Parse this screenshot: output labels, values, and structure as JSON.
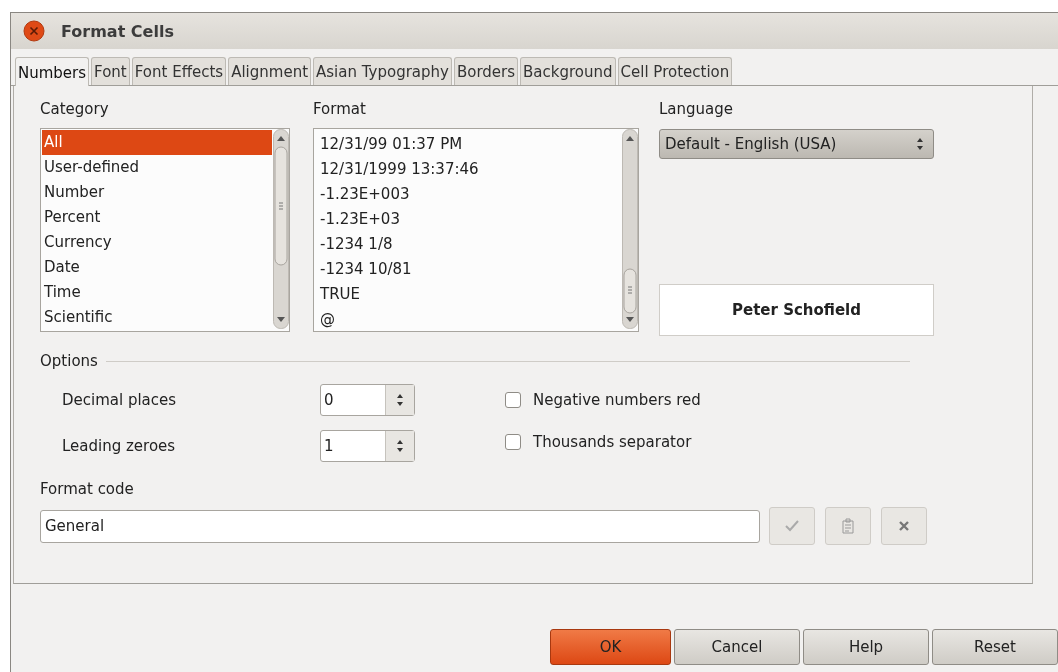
{
  "window": {
    "title": "Format Cells"
  },
  "tabs": [
    {
      "label": "Numbers",
      "selected": true
    },
    {
      "label": "Font",
      "selected": false
    },
    {
      "label": "Font Effects",
      "selected": false
    },
    {
      "label": "Alignment",
      "selected": false
    },
    {
      "label": "Asian Typography",
      "selected": false
    },
    {
      "label": "Borders",
      "selected": false
    },
    {
      "label": "Background",
      "selected": false
    },
    {
      "label": "Cell Protection",
      "selected": false
    }
  ],
  "category": {
    "label": "Category",
    "items": [
      {
        "label": "All",
        "selected": true
      },
      {
        "label": "User-defined",
        "selected": false
      },
      {
        "label": "Number",
        "selected": false
      },
      {
        "label": "Percent",
        "selected": false
      },
      {
        "label": "Currency",
        "selected": false
      },
      {
        "label": "Date",
        "selected": false
      },
      {
        "label": "Time",
        "selected": false
      },
      {
        "label": "Scientific",
        "selected": false
      }
    ]
  },
  "format": {
    "label": "Format",
    "items": [
      "12/31/99 01:37 PM",
      "12/31/1999 13:37:46",
      "-1.23E+003",
      "-1.23E+03",
      "-1234 1/8",
      "-1234 10/81",
      "TRUE",
      "@"
    ]
  },
  "language": {
    "label": "Language",
    "value": "Default - English (USA)"
  },
  "preview": {
    "text": "Peter Schofield"
  },
  "options": {
    "title": "Options",
    "spinners": [
      {
        "label": "Decimal places",
        "value": "0"
      },
      {
        "label": "Leading zeroes",
        "value": "1"
      }
    ],
    "checkboxes": [
      {
        "label": "Negative numbers red",
        "checked": false
      },
      {
        "label": "Thousands separator",
        "checked": false
      }
    ]
  },
  "format_code": {
    "label": "Format code",
    "value": "General"
  },
  "buttons": [
    {
      "label": "OK",
      "kind": "primary"
    },
    {
      "label": "Cancel",
      "kind": "normal"
    },
    {
      "label": "Help",
      "kind": "normal"
    },
    {
      "label": "Reset",
      "kind": "normal"
    }
  ]
}
